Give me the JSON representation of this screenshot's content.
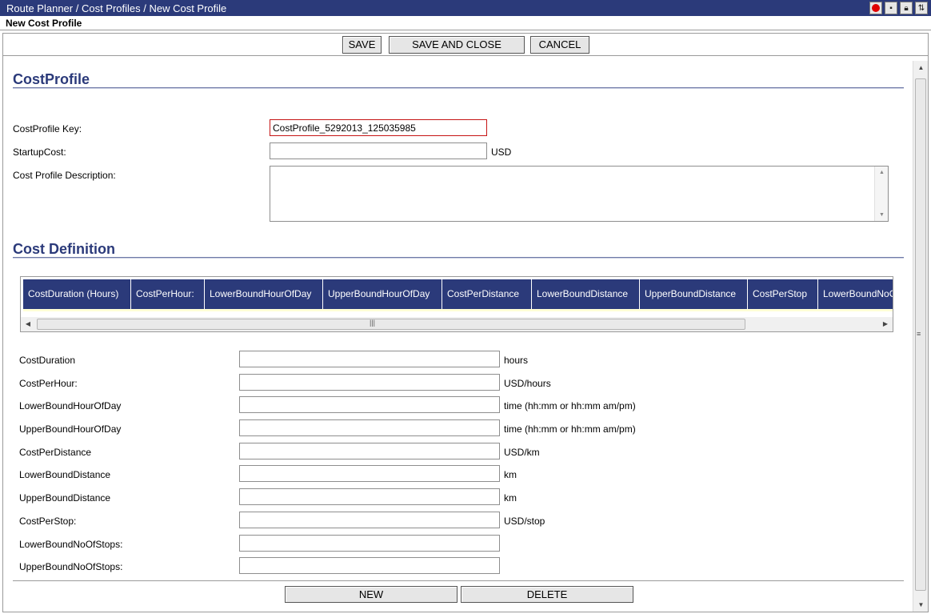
{
  "window": {
    "breadcrumb": "Route Planner / Cost Profiles / New Cost Profile"
  },
  "titlebar_icons": [
    "record-icon",
    "save-disk-icon",
    "lock-icon",
    "refresh-icon"
  ],
  "page_heading": "New Cost Profile",
  "toolbar": {
    "save": "SAVE",
    "save_and_close": "SAVE AND CLOSE",
    "cancel": "CANCEL"
  },
  "cost_profile": {
    "title": "CostProfile",
    "key_label": "CostProfile Key:",
    "key_value": "CostProfile_5292013_125035985",
    "startup_label": "StartupCost:",
    "startup_value": "",
    "startup_unit": "USD",
    "description_label": "Cost Profile Description:",
    "description_value": ""
  },
  "cost_definition": {
    "title": "Cost Definition",
    "columns": [
      "CostDuration (Hours)",
      "CostPerHour:",
      "LowerBoundHourOfDay",
      "UpperBoundHourOfDay",
      "CostPerDistance",
      "LowerBoundDistance",
      "UpperBoundDistance",
      "CostPerStop",
      "LowerBoundNoOf"
    ],
    "fields": [
      {
        "label": "CostDuration",
        "value": "",
        "unit": "hours"
      },
      {
        "label": "CostPerHour:",
        "value": "",
        "unit": "USD/hours"
      },
      {
        "label": "LowerBoundHourOfDay",
        "value": "",
        "unit": "time (hh:mm or hh:mm am/pm)"
      },
      {
        "label": "UpperBoundHourOfDay",
        "value": "",
        "unit": "time (hh:mm or hh:mm am/pm)"
      },
      {
        "label": "CostPerDistance",
        "value": "",
        "unit": "USD/km"
      },
      {
        "label": "LowerBoundDistance",
        "value": "",
        "unit": "km"
      },
      {
        "label": "UpperBoundDistance",
        "value": "",
        "unit": "km"
      },
      {
        "label": "CostPerStop:",
        "value": "",
        "unit": "USD/stop"
      },
      {
        "label": "LowerBoundNoOfStops:",
        "value": "",
        "unit": ""
      },
      {
        "label": "UpperBoundNoOfStops:",
        "value": "",
        "unit": ""
      }
    ],
    "new_button": "NEW",
    "delete_button": "DELETE"
  },
  "colors": {
    "header_bg": "#2b3a7a",
    "section_title": "#2b3a7a",
    "error_border": "#c61414"
  }
}
